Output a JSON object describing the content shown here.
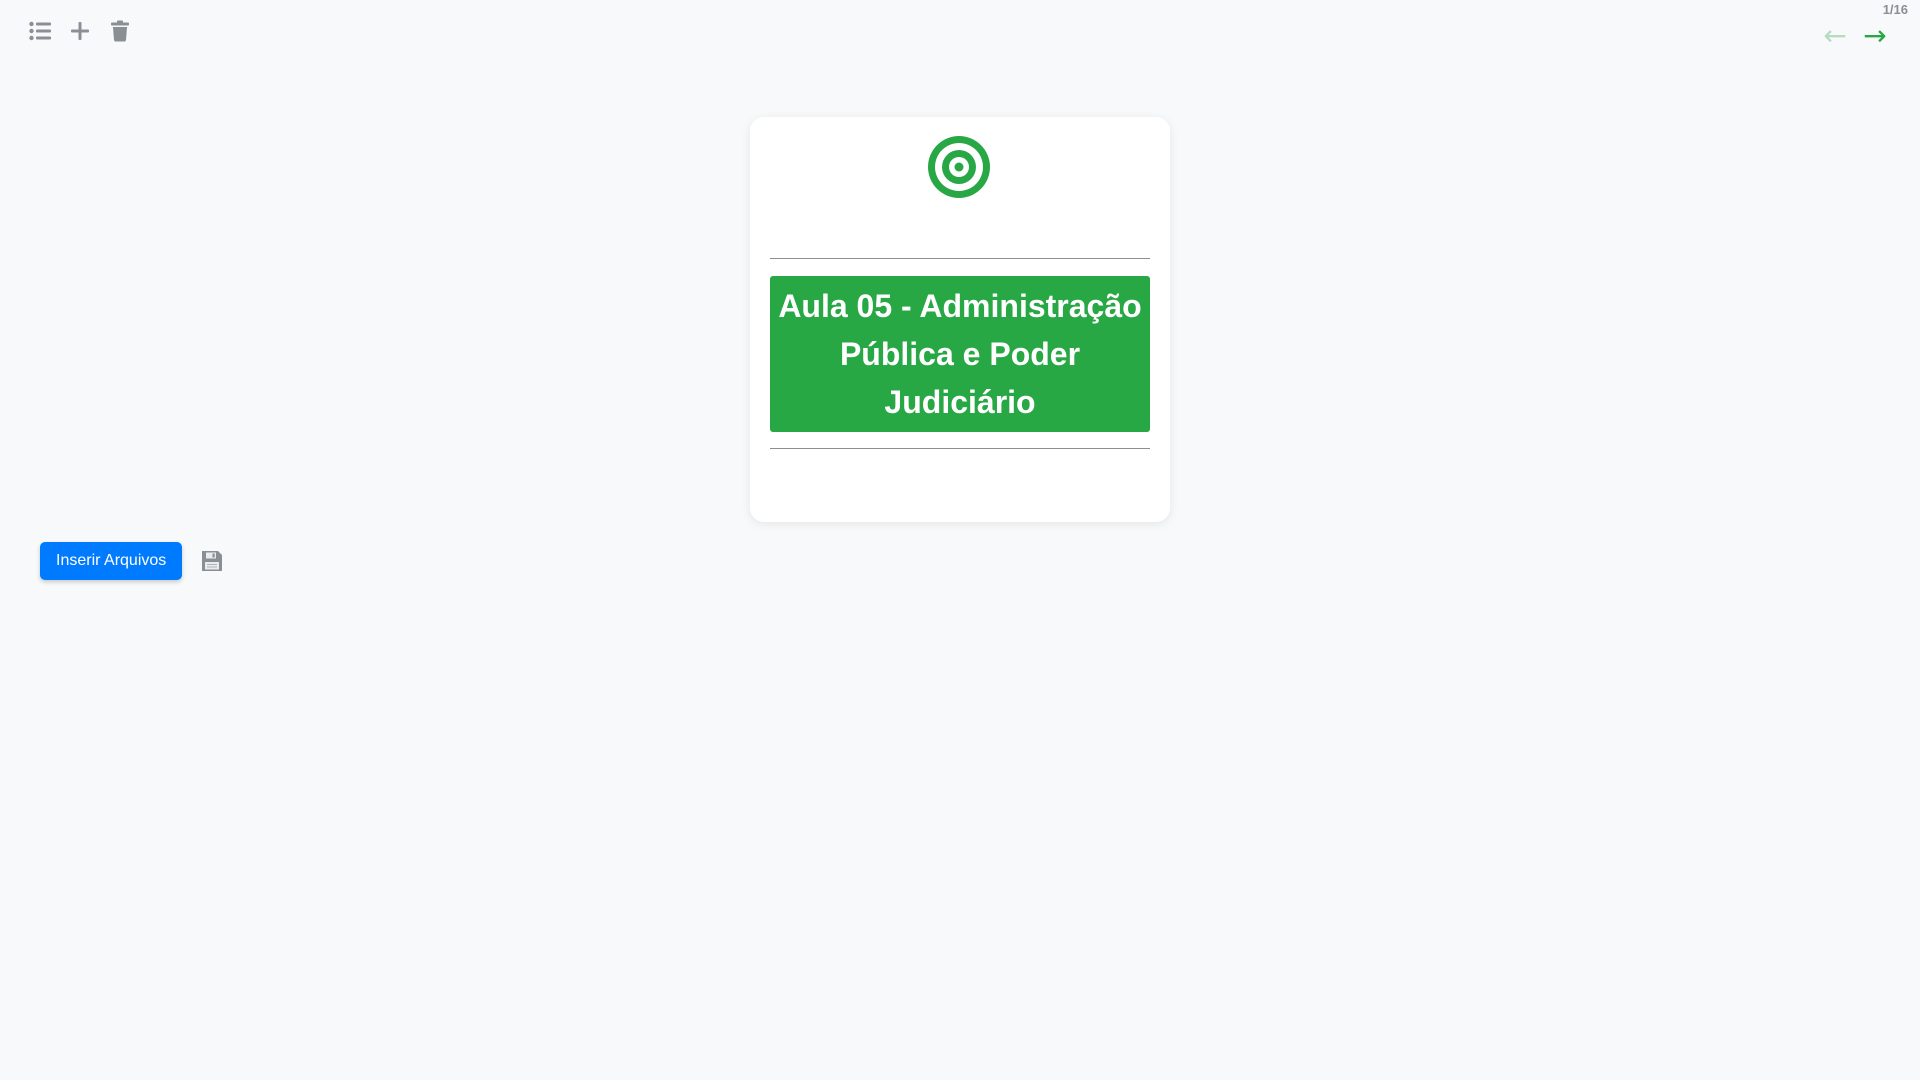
{
  "toolbar": {
    "icons": [
      "list-icon",
      "plus-icon",
      "trash-icon"
    ]
  },
  "pagination": {
    "counter": "1/16",
    "prev_arrow": "←",
    "next_arrow": "→"
  },
  "card": {
    "icon": "target-icon",
    "title": "Aula 05 - Administração Pública e Poder Judiciário"
  },
  "actions": {
    "insert_files_label": "Inserir Arquivos",
    "save_icon": "floppy-disk-icon"
  },
  "colors": {
    "accent_green": "#28a745",
    "primary_blue": "#007bff",
    "icon_gray": "#8a8f95"
  }
}
